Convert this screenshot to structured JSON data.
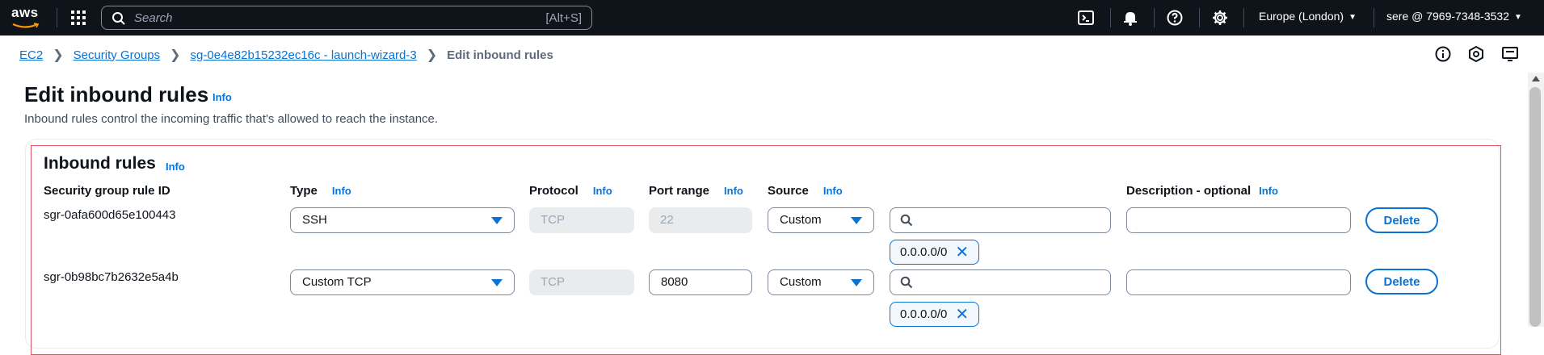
{
  "topnav": {
    "logo_text": "aws",
    "search_placeholder": "Search",
    "search_shortcut": "[Alt+S]",
    "icons": [
      "cloudshell-icon",
      "bell-icon",
      "help-icon",
      "gear-icon"
    ],
    "region": "Europe (London)",
    "account": "sere @ 7969-7348-3532"
  },
  "breadcrumb": {
    "items": [
      "EC2",
      "Security Groups",
      "sg-0e4e82b15232ec16c - launch-wizard-3"
    ],
    "current": "Edit inbound rules"
  },
  "header": {
    "title": "Edit inbound rules",
    "info": "Info",
    "description": "Inbound rules control the incoming traffic that's allowed to reach the instance."
  },
  "section": {
    "title": "Inbound rules",
    "info": "Info",
    "columns": {
      "rule_id": "Security group rule ID",
      "type": "Type",
      "protocol": "Protocol",
      "port_range": "Port range",
      "source": "Source",
      "description": "Description - optional",
      "info": "Info"
    }
  },
  "rules": [
    {
      "id": "sgr-0afa600d65e100443",
      "type": "SSH",
      "protocol": "TCP",
      "port": "22",
      "source": "Custom",
      "cidr": "0.0.0.0/0",
      "description": "",
      "delete_label": "Delete"
    },
    {
      "id": "sgr-0b98bc7b2632e5a4b",
      "type": "Custom TCP",
      "protocol": "TCP",
      "port": "8080",
      "source": "Custom",
      "cidr": "0.0.0.0/0",
      "description": "",
      "delete_label": "Delete"
    }
  ],
  "colors": {
    "nav_bg": "#0f141a",
    "link": "#0972d3",
    "error_border": "#e05260"
  }
}
